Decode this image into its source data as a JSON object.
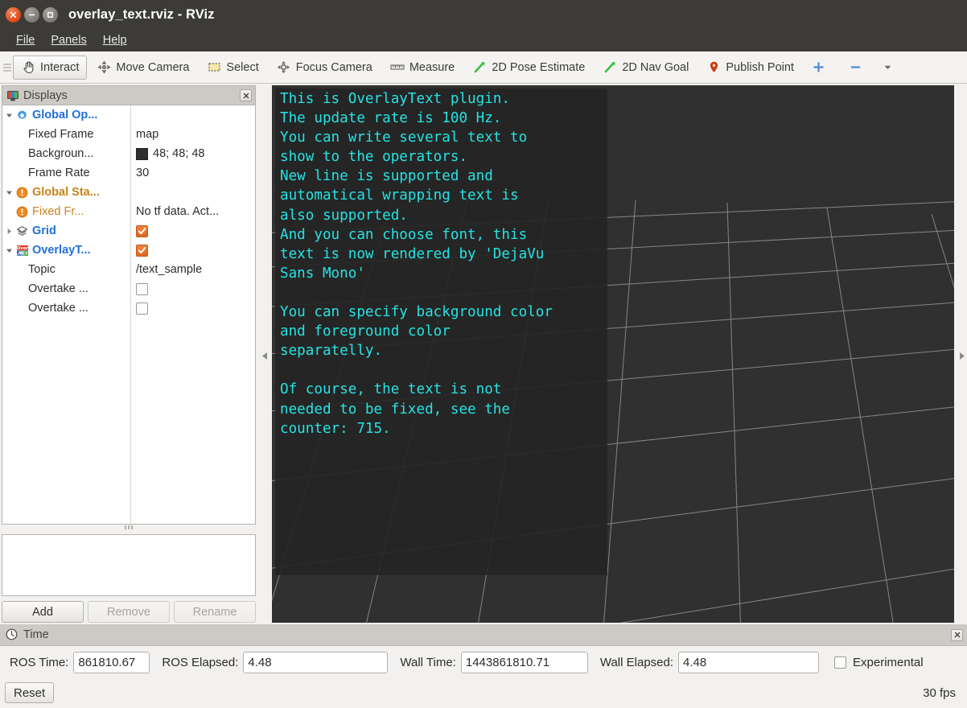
{
  "window": {
    "title": "overlay_text.rviz - RViz",
    "buttons": {
      "close": "close-icon",
      "minimize": "minimize-icon",
      "maximize": "maximize-icon"
    }
  },
  "menubar": {
    "items": [
      {
        "label": "File",
        "mnemonic": "F"
      },
      {
        "label": "Panels",
        "mnemonic": "P"
      },
      {
        "label": "Help",
        "mnemonic": "H"
      }
    ]
  },
  "toolbar": {
    "buttons": [
      {
        "label": "Interact",
        "icon": "hand-cursor-icon",
        "active": true
      },
      {
        "label": "Move Camera",
        "icon": "move-camera-icon",
        "active": false
      },
      {
        "label": "Select",
        "icon": "select-rect-icon",
        "active": false
      },
      {
        "label": "Focus Camera",
        "icon": "focus-camera-icon",
        "active": false
      },
      {
        "label": "Measure",
        "icon": "ruler-icon",
        "active": false
      },
      {
        "label": "2D Pose Estimate",
        "icon": "green-arrow-icon",
        "active": false
      },
      {
        "label": "2D Nav Goal",
        "icon": "green-arrow-icon",
        "active": false
      },
      {
        "label": "Publish Point",
        "icon": "map-pin-icon",
        "active": false
      },
      {
        "label": "",
        "icon": "plus-icon",
        "active": false
      },
      {
        "label": "",
        "icon": "minus-icon",
        "active": false
      },
      {
        "label": "",
        "icon": "chevron-down-icon",
        "active": false
      }
    ]
  },
  "displays": {
    "panel_title": "Displays",
    "panel_icon": "monitor-icon",
    "close_icon": "close-icon",
    "rows": [
      {
        "indent": 0,
        "arrow": "down",
        "icon": "gear-icon",
        "label": "Global Op...",
        "style": "cat",
        "value_type": "none",
        "value": ""
      },
      {
        "indent": 1,
        "arrow": "none",
        "icon": "none",
        "label": "Fixed Frame",
        "style": "prop",
        "value_type": "text",
        "value": "map"
      },
      {
        "indent": 1,
        "arrow": "none",
        "icon": "none",
        "label": "Backgroun...",
        "style": "prop",
        "value_type": "color",
        "value": "48; 48; 48",
        "swatch": "#303030"
      },
      {
        "indent": 1,
        "arrow": "none",
        "icon": "none",
        "label": "Frame Rate",
        "style": "prop",
        "value_type": "text",
        "value": "30"
      },
      {
        "indent": 0,
        "arrow": "down",
        "icon": "warning-icon",
        "label": "Global Sta...",
        "style": "warn",
        "value_type": "none",
        "value": ""
      },
      {
        "indent": 1,
        "arrow": "none",
        "icon": "warning-icon",
        "label": "Fixed Fr...",
        "style": "warn-sub",
        "value_type": "text",
        "value": "No tf data.  Act..."
      },
      {
        "indent": 0,
        "arrow": "right",
        "icon": "grid-layers-icon",
        "label": "Grid",
        "style": "cat",
        "value_type": "checkbox",
        "value": "",
        "checked": true
      },
      {
        "indent": 0,
        "arrow": "down",
        "icon": "overlaytext-icon",
        "label": "OverlayT...",
        "style": "cat",
        "value_type": "checkbox",
        "value": "",
        "checked": true
      },
      {
        "indent": 1,
        "arrow": "none",
        "icon": "none",
        "label": "Topic",
        "style": "prop",
        "value_type": "text",
        "value": "/text_sample"
      },
      {
        "indent": 1,
        "arrow": "none",
        "icon": "none",
        "label": "Overtake ...",
        "style": "prop",
        "value_type": "checkbox",
        "value": "",
        "checked": false
      },
      {
        "indent": 1,
        "arrow": "none",
        "icon": "none",
        "label": "Overtake ...",
        "style": "prop",
        "value_type": "checkbox",
        "value": "",
        "checked": false
      }
    ],
    "buttons": [
      {
        "label": "Add",
        "enabled": true
      },
      {
        "label": "Remove",
        "enabled": false
      },
      {
        "label": "Rename",
        "enabled": false
      }
    ]
  },
  "render_view": {
    "background_color": "#303030",
    "grid_color": "#9a9a9a",
    "overlay": {
      "background_color": "#252525",
      "foreground_color": "#27e2e2",
      "font": "DejaVu Sans Mono",
      "text": "This is OverlayText plugin.\nThe update rate is 100 Hz.\nYou can write several text to\nshow to the operators.\nNew line is supported and\nautomatical wrapping text is\nalso supported.\nAnd you can choose font, this\ntext is now rendered by 'DejaVu\nSans Mono'\n\nYou can specify background color\nand foreground color\nseparatelly.\n\nOf course, the text is not\nneeded to be fixed, see the\ncounter: 715."
    },
    "splitter_left_icon": "collapse-left-icon",
    "splitter_right_icon": "collapse-right-icon"
  },
  "time_panel": {
    "panel_title": "Time",
    "panel_icon": "clock-icon",
    "close_icon": "close-icon",
    "fields": [
      {
        "label": "ROS Time:",
        "value": "861810.67"
      },
      {
        "label": "ROS Elapsed:",
        "value": "4.48"
      },
      {
        "label": "Wall Time:",
        "value": "1443861810.71"
      },
      {
        "label": "Wall Elapsed:",
        "value": "4.48"
      }
    ],
    "experimental": {
      "label": "Experimental",
      "checked": false
    },
    "reset_button": "Reset",
    "fps": "30 fps"
  }
}
